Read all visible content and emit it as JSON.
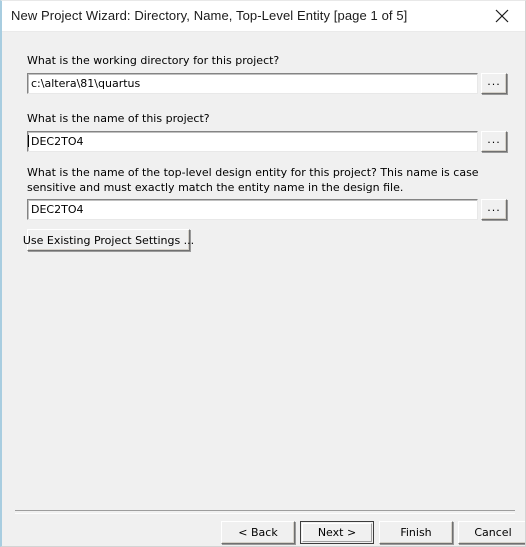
{
  "window": {
    "title": "New Project Wizard: Directory, Name, Top-Level Entity [page 1 of 5]",
    "close_icon": "close-icon",
    "accent_border_color": "#a8cde0",
    "titlebar_bg": "#ffffff",
    "body_bg": "#f0f0f0"
  },
  "fields": [
    {
      "label": "What is the working directory for this project?",
      "value": "c:\\altera\\81\\quartus",
      "placeholder": "",
      "browse_label": "...",
      "has_caret": false
    },
    {
      "label": "What is the name of this project?",
      "value": "DEC2TO4",
      "placeholder": "",
      "browse_label": "...",
      "has_caret": true
    },
    {
      "label": "What is the name of the top-level design entity for this project? This name is case sensitive and must exactly match the entity name in the design file.",
      "value": "DEC2TO4",
      "placeholder": "",
      "browse_label": "...",
      "has_caret": false
    }
  ],
  "use_existing_button": {
    "label": "Use Existing Project Settings ..."
  },
  "footer": {
    "back_label": "< Back",
    "next_label": "Next >",
    "finish_label": "Finish",
    "cancel_label": "Cancel",
    "default_button": "Next >"
  }
}
